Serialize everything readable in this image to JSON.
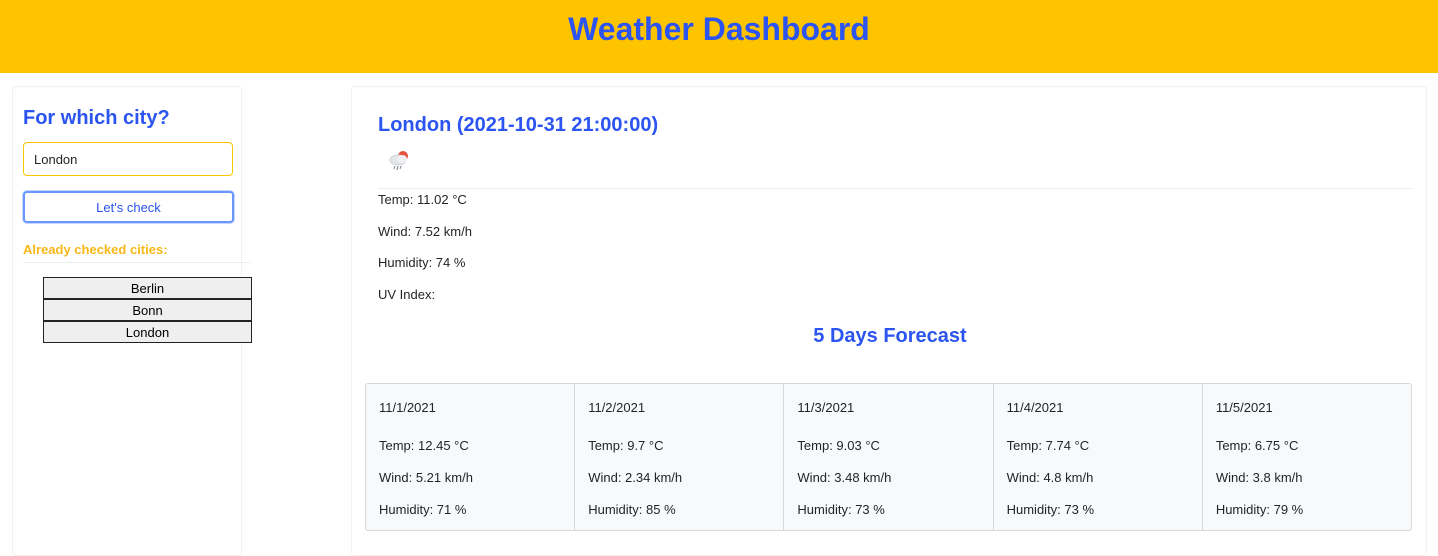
{
  "header": {
    "title": "Weather Dashboard"
  },
  "sidebar": {
    "heading": "For which city?",
    "search_value": "London",
    "check_label": "Let's check",
    "history_label": "Already checked cities:",
    "history": [
      "Berlin",
      "Bonn",
      "London"
    ]
  },
  "current": {
    "title": "London (2021-10-31 21:00:00)",
    "icon": "rain-cloud-icon",
    "temp": "Temp: 11.02 °C",
    "wind": "Wind: 7.52 km/h",
    "humidity": "Humidity: 74 %",
    "uv": "UV Index:"
  },
  "forecast": {
    "title": "5 Days Forecast",
    "days": [
      {
        "date": "11/1/2021",
        "temp": "Temp: 12.45 °C",
        "wind": "Wind: 5.21 km/h",
        "humidity": "Humidity: 71 %"
      },
      {
        "date": "11/2/2021",
        "temp": "Temp: 9.7 °C",
        "wind": "Wind: 2.34 km/h",
        "humidity": "Humidity: 85 %"
      },
      {
        "date": "11/3/2021",
        "temp": "Temp: 9.03 °C",
        "wind": "Wind: 3.48 km/h",
        "humidity": "Humidity: 73 %"
      },
      {
        "date": "11/4/2021",
        "temp": "Temp: 7.74 °C",
        "wind": "Wind: 4.8 km/h",
        "humidity": "Humidity: 73 %"
      },
      {
        "date": "11/5/2021",
        "temp": "Temp: 6.75 °C",
        "wind": "Wind: 3.8 km/h",
        "humidity": "Humidity: 79 %"
      }
    ]
  },
  "colors": {
    "header_bg": "#ffc400",
    "accent_blue": "#2b54f0",
    "accent_yellow": "#f7b719"
  }
}
